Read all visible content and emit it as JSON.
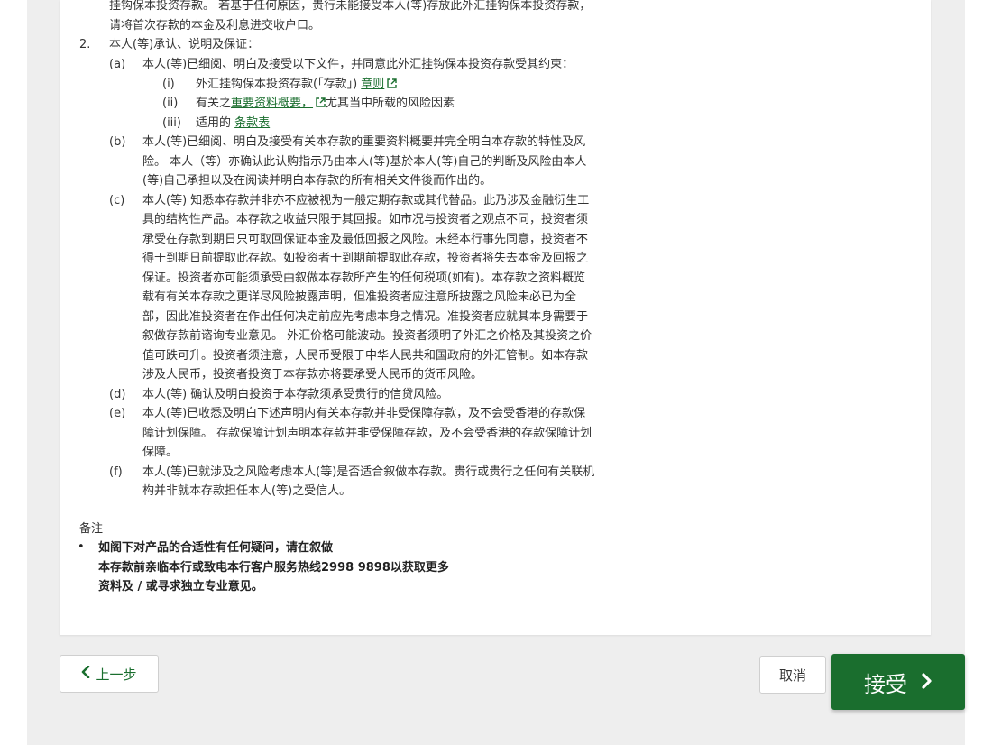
{
  "intro": {
    "line1": "挂钩保本投资存款。 若基于任何原因，贵行未能接受本人(等)存放此外汇挂钩保本投资存款，",
    "line2": "请将首次存款的本金及利息进交收户口。"
  },
  "section2": {
    "number": "2.",
    "title": "本人(等)承认、说明及保证：",
    "a": {
      "label": "(a)",
      "text": "本人(等)已细阅、明白及接受以下文件，并同意此外汇挂钩保本投资存款受其约束：",
      "i": {
        "label": "(i)",
        "prefix": "外汇挂钩保本投资存款(「存款」) ",
        "link": "章则"
      },
      "ii": {
        "label": "(ii)",
        "prefix": "有关之",
        "link": "重要资料概要，",
        "suffix": "尤其当中所载的风险因素"
      },
      "iii": {
        "label": "(iii)",
        "prefix": "适用的 ",
        "link": "条款表"
      }
    },
    "b": {
      "label": "(b)",
      "lines": [
        "本人(等)已细阅、明白及接受有关本存款的重要资料概要并完全明白本存款的特性及风",
        "险。 本人（等）亦确认此认购指示乃由本人(等)基於本人(等)自己的判断及风险由本人",
        "(等)自己承担以及在阅读并明白本存款的所有相关文件後而作出的。"
      ]
    },
    "c": {
      "label": "(c)",
      "lines": [
        "本人(等) 知悉本存款并非亦不应被视为一般定期存款或其代替品。此乃涉及金融衍生工",
        "具的结构性产品。本存款之收益只限于其回报。如市况与投资者之观点不同，投资者须",
        "承受在存款到期日只可取回保证本金及最低回报之风险。未经本行事先同意，投资者不",
        "得于到期日前提取此存款。如投资者于到期前提取此存款，投资者将失去本金及回报之",
        "保证。投资者亦可能须承受由叙做本存款所产生的任何税项(如有)。本存款之资料概览",
        "载有有关本存款之更详尽风险披露声明，但准投资者应注意所披露之风险未必已为全",
        "部，因此准投资者在作出任何决定前应先考虑本身之情况。准投资者应就其本身需要于",
        "叙做存款前谘询专业意见。 外汇价格可能波动。投资者须明了外汇之价格及其投资之价",
        "值可跌可升。投资者须注意，人民币受限于中华人民共和国政府的外汇管制。如本存款",
        "涉及人民币，投资者投资于本存款亦将要承受人民币的货币风险。"
      ]
    },
    "d": {
      "label": "(d)",
      "lines": [
        "本人(等) 确认及明白投资于本存款须承受贵行的信贷风险。"
      ]
    },
    "e": {
      "label": "(e)",
      "lines": [
        "本人(等)已收悉及明白下述声明内有关本存款并非受保障存款，及不会受香港的存款保",
        "障计划保障。 存款保障计划声明本存款并非受保障存款，及不会受香港的存款保障计划",
        "保障。"
      ]
    },
    "f": {
      "label": "(f)",
      "lines": [
        "本人(等)已就涉及之风险考虑本人(等)是否适合叙做本存款。贵行或贵行之任何有关联机",
        "构并非就本存款担任本人(等)之受信人。"
      ]
    }
  },
  "remarks": {
    "title": "备注",
    "bullet": "•",
    "lines": [
      "如阁下对产品的合适性有任何疑问，请在叙做",
      "本存款前亲临本行或致电本行客户服务热线2998 9898以获取更多",
      "资料及 / 或寻求独立专业意见。"
    ]
  },
  "footer": {
    "back_label": "上一步",
    "cancel_label": "取消",
    "accept_label": "接受"
  },
  "colors": {
    "brand_green": "#1a6e2e",
    "link_green": "#1a6e2e"
  }
}
